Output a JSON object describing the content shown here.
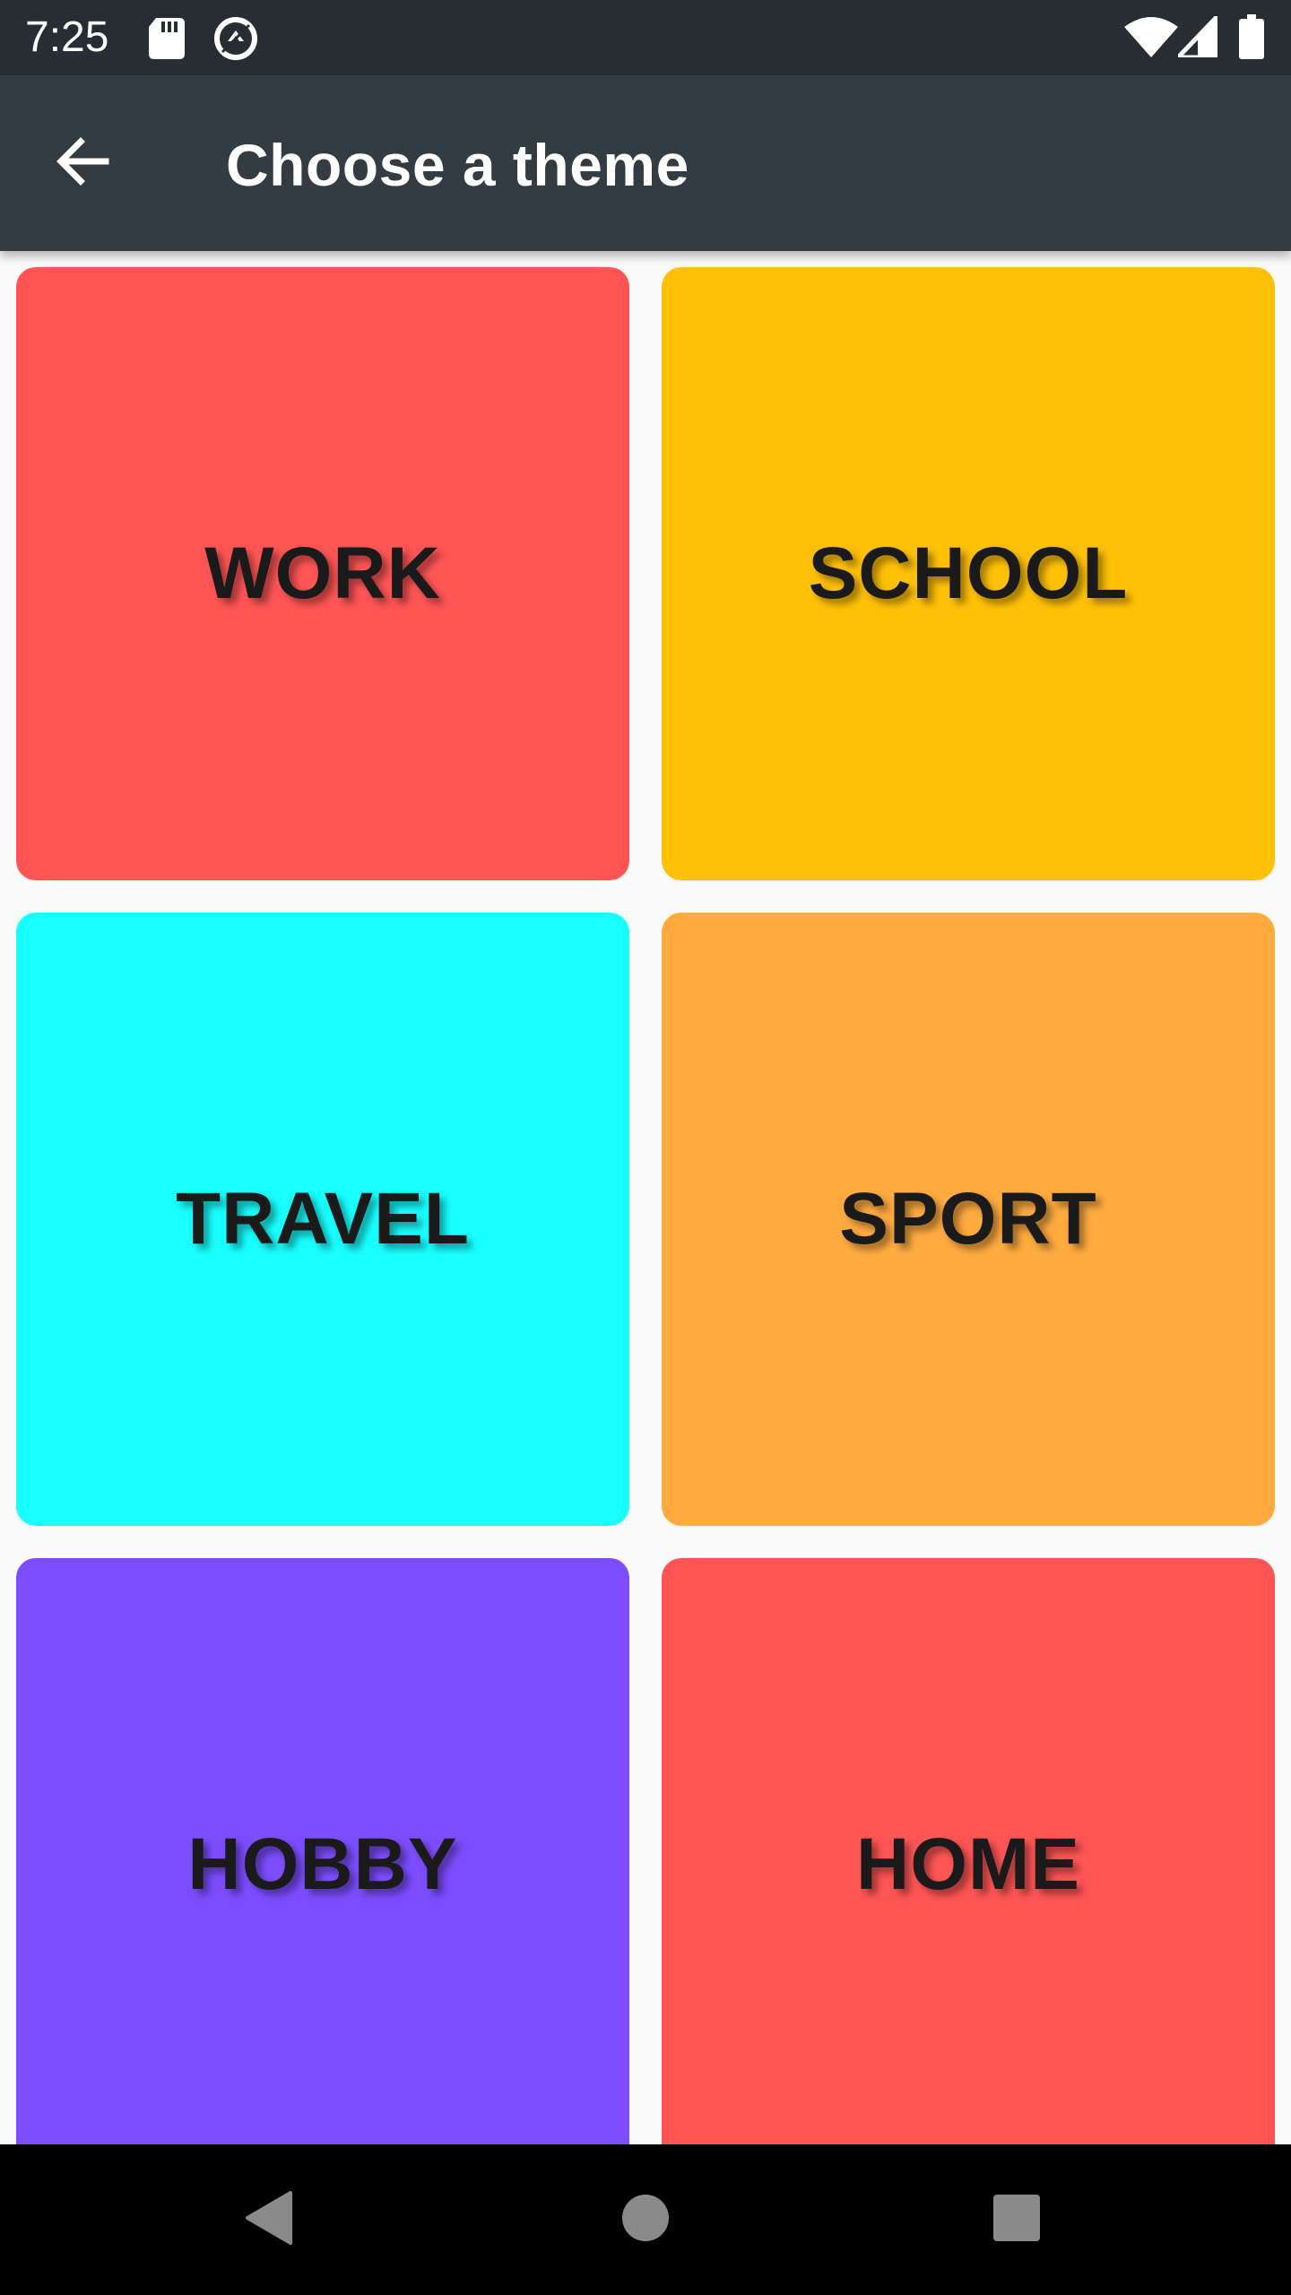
{
  "status_bar": {
    "time": "7:25",
    "left_icons": [
      "sd-card-icon",
      "data-saver-icon"
    ],
    "right_icons": [
      "wifi-icon",
      "signal-icon",
      "battery-icon"
    ]
  },
  "app_bar": {
    "title": "Choose a theme",
    "back_icon": "arrow-back-icon"
  },
  "themes": [
    {
      "label": "WORK",
      "color": "#ff5555"
    },
    {
      "label": "SCHOOL",
      "color": "#ffc107"
    },
    {
      "label": "TRAVEL",
      "color": "#18ffff"
    },
    {
      "label": "SPORT",
      "color": "#ffab40"
    },
    {
      "label": "HOBBY",
      "color": "#7c4dff"
    },
    {
      "label": "HOME",
      "color": "#ff5555"
    }
  ],
  "nav_bar": {
    "buttons": [
      "nav-back-icon",
      "nav-home-icon",
      "nav-recents-icon"
    ]
  }
}
